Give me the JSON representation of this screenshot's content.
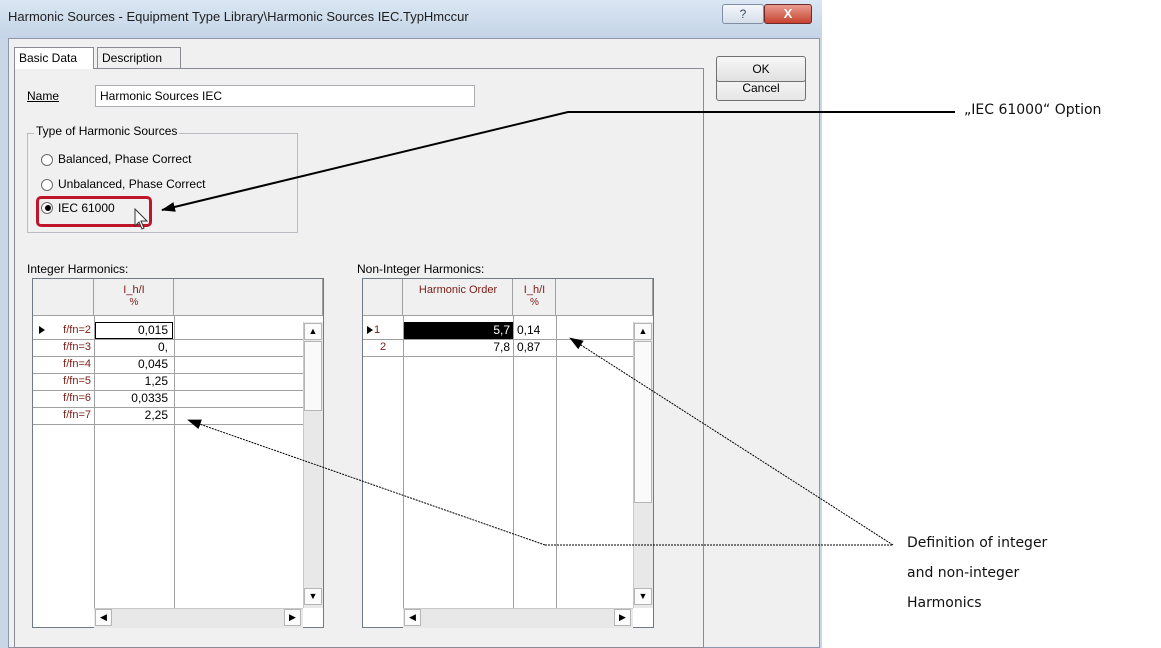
{
  "window": {
    "title": "Harmonic Sources - Equipment Type Library\\Harmonic Sources IEC.TypHmccur",
    "help_glyph": "?",
    "close_glyph": "X"
  },
  "tabs": [
    {
      "label": "Basic Data",
      "active": true
    },
    {
      "label": "Description",
      "active": false
    }
  ],
  "name": {
    "label": "Name",
    "value": "Harmonic Sources IEC"
  },
  "type_group": {
    "title": "Type of Harmonic Sources",
    "options": [
      {
        "label": "Balanced, Phase Correct",
        "selected": false
      },
      {
        "label": "Unbalanced, Phase Correct",
        "selected": false
      },
      {
        "label": "IEC 61000",
        "selected": true
      }
    ]
  },
  "integer_harmonics": {
    "title": "Integer Harmonics:",
    "header_line1": "I_h/I",
    "header_line2": "%",
    "rows": [
      {
        "label": "f/fn=2",
        "value": "0,015"
      },
      {
        "label": "f/fn=3",
        "value": "0,"
      },
      {
        "label": "f/fn=4",
        "value": "0,045"
      },
      {
        "label": "f/fn=5",
        "value": "1,25"
      },
      {
        "label": "f/fn=6",
        "value": "0,0335"
      },
      {
        "label": "f/fn=7",
        "value": "2,25"
      }
    ]
  },
  "non_integer_harmonics": {
    "title": "Non-Integer Harmonics:",
    "col1_header": "Harmonic Order",
    "col2_header_line1": "I_h/I",
    "col2_header_line2": "%",
    "rows": [
      {
        "label": "1",
        "order": "5,7",
        "value": "0,14"
      },
      {
        "label": "2",
        "order": "7,8",
        "value": "0,87"
      }
    ]
  },
  "buttons": {
    "ok": "OK",
    "cancel": "Cancel"
  },
  "annotations": {
    "option": "„IEC 61000“ Option",
    "definition_line1": "Definition of integer",
    "definition_line2": "and non-integer",
    "definition_line3": "Harmonics"
  },
  "colors": {
    "highlight": "#c0142b",
    "header_text": "#7b1b14"
  }
}
